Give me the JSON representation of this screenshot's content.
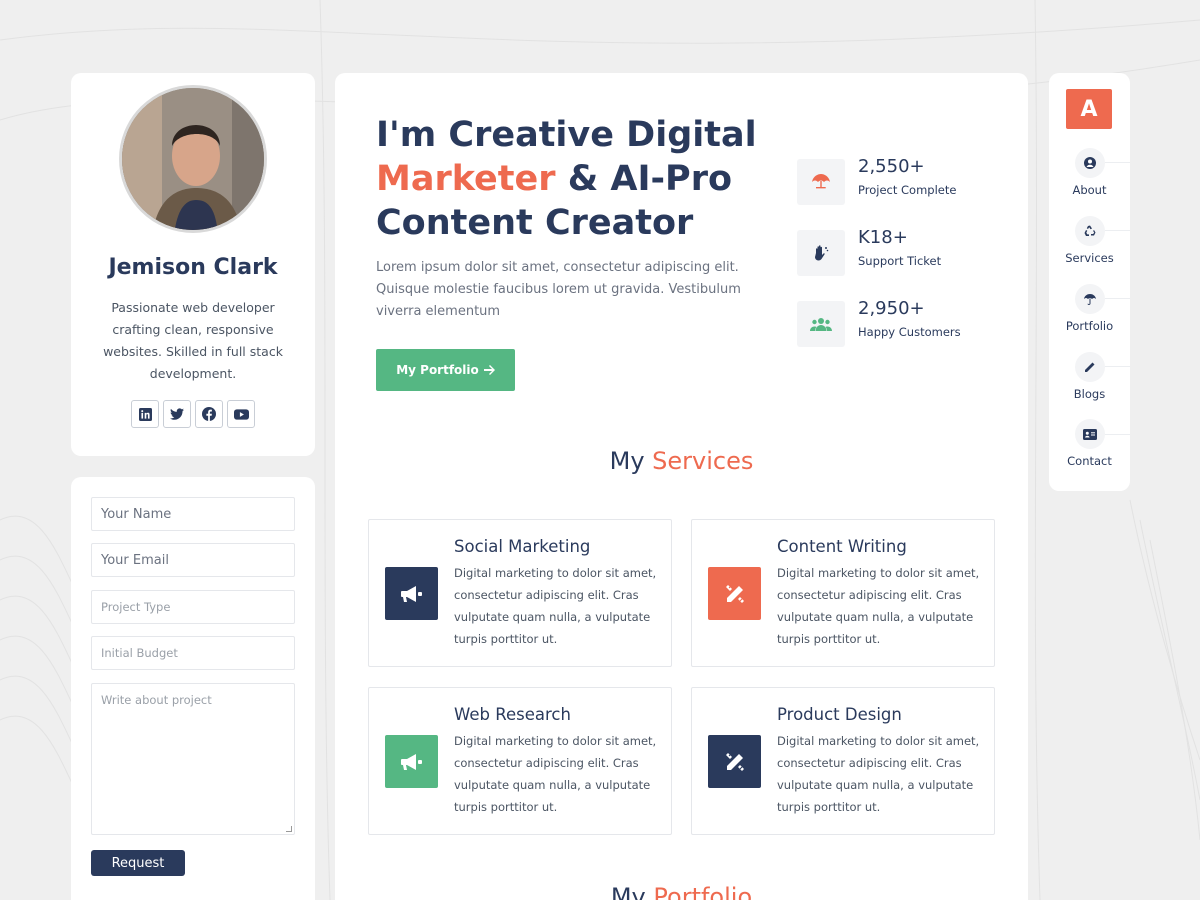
{
  "colors": {
    "navy": "#2a3a5c",
    "accent": "#ee6a4f",
    "green": "#55b783",
    "background": "#efefef"
  },
  "profile": {
    "name": "Jemison Clark",
    "bio": "Passionate web developer crafting clean, responsive websites. Skilled in full stack development.",
    "socials": [
      "linkedin-icon",
      "twitter-icon",
      "facebook-icon",
      "youtube-icon"
    ]
  },
  "form": {
    "name_placeholder": "Your Name",
    "email_placeholder": "Your Email",
    "project_type_placeholder": "Project Type",
    "budget_placeholder": "Initial Budget",
    "message_placeholder": "Write about project",
    "submit_label": "Request"
  },
  "hero": {
    "title_line1": "I'm Creative Digital",
    "title_accent": "Marketer",
    "title_line2_rest": " & AI-Pro",
    "title_line3": "Content Creator",
    "description": "Lorem ipsum dolor sit amet, consectetur adipiscing elit. Quisque molestie faucibus lorem ut gravida. Vestibulum viverra elementum",
    "button_label": "My Portfolio"
  },
  "stats": [
    {
      "value": "2,550+",
      "label": "Project Complete",
      "icon": "umbrella-icon"
    },
    {
      "value": "K18+",
      "label": "Support Ticket",
      "icon": "hand-icon"
    },
    {
      "value": "2,950+",
      "label": "Happy Customers",
      "icon": "users-icon"
    }
  ],
  "services_section": {
    "title_prefix": "My",
    "title_accent": "Services",
    "items": [
      {
        "title": "Social Marketing",
        "description": "Digital marketing to dolor sit amet, consectetur adipiscing elit. Cras vulputate quam nulla, a vulputate turpis porttitor ut.",
        "icon": "megaphone-icon",
        "color": "#2a3a5c"
      },
      {
        "title": "Content Writing",
        "description": "Digital marketing to dolor sit amet, consectetur adipiscing elit. Cras vulputate quam nulla, a vulputate turpis porttitor ut.",
        "icon": "pencil-ruler-icon",
        "color": "#ee6a4f"
      },
      {
        "title": "Web Research",
        "description": "Digital marketing to dolor sit amet, consectetur adipiscing elit. Cras vulputate quam nulla, a vulputate turpis porttitor ut.",
        "icon": "megaphone-icon",
        "color": "#55b783"
      },
      {
        "title": "Product Design",
        "description": "Digital marketing to dolor sit amet, consectetur adipiscing elit. Cras vulputate quam nulla, a vulputate turpis porttitor ut.",
        "icon": "pencil-ruler-icon",
        "color": "#2a3a5c"
      }
    ]
  },
  "portfolio_section": {
    "title_prefix": "My",
    "title_accent": "Portfolio"
  },
  "nav": {
    "logo_letter": "A",
    "items": [
      {
        "label": "About",
        "icon": "user-icon"
      },
      {
        "label": "Services",
        "icon": "recycle-icon"
      },
      {
        "label": "Portfolio",
        "icon": "umbrella-icon"
      },
      {
        "label": "Blogs",
        "icon": "pencil-icon"
      },
      {
        "label": "Contact",
        "icon": "id-card-icon"
      }
    ]
  }
}
